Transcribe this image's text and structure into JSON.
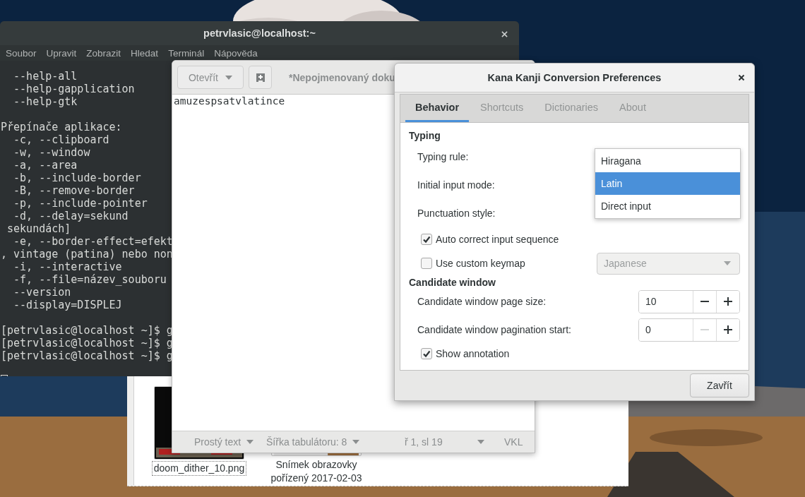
{
  "terminal": {
    "title": "petrvlasic@localhost:~",
    "menu": [
      "Soubor",
      "Upravit",
      "Zobrazit",
      "Hledat",
      "Terminál",
      "Nápověda"
    ],
    "line_groups": [
      [
        "  --help-all",
        "  --help-gapplication",
        "  --help-gtk"
      ],
      [
        "Přepínače aplikace:",
        "  -c, --clipboard",
        "  -w, --window",
        "  -a, --area",
        "  -b, --include-border",
        "  -B, --remove-border",
        "  -p, --include-pointer",
        "  -d, --delay=sekund",
        " sekundách]",
        "  -e, --border-effect=efekt",
        ", vintage (patina) nebo non",
        "  -i, --interactive",
        "  -f, --file=název_souboru",
        "  --version",
        "  --display=DISPLEJ"
      ],
      [
        "[petrvlasic@localhost ~]$ g",
        "[petrvlasic@localhost ~]$ g",
        "[petrvlasic@localhost ~]$ g"
      ]
    ]
  },
  "file_manager": {
    "files": [
      {
        "name_lines": [
          "doom_dither_10.png"
        ],
        "focused": true
      },
      {
        "name_lines": [
          "Snímek obrazovky",
          "pořízený 2017-02-03"
        ],
        "focused": false
      }
    ]
  },
  "text_editor": {
    "open_button": "Otevřít",
    "title": "*Nepojmenovaný doku",
    "content": "amuzespsatvlatince",
    "status_bar": {
      "language": "Prostý text",
      "tab_width": "Šířka tabulátoru: 8",
      "position": "ř 1, sl 19",
      "mode": "VKL"
    }
  },
  "dialog": {
    "title": "Kana Kanji Conversion Preferences",
    "tabs": [
      {
        "label": "Behavior",
        "selected": true
      },
      {
        "label": "Shortcuts",
        "selected": false
      },
      {
        "label": "Dictionaries",
        "selected": false
      },
      {
        "label": "About",
        "selected": false
      }
    ],
    "sections": [
      {
        "heading": "Typing",
        "rows": [
          {
            "kind": "combo",
            "label": "Typing rule:"
          },
          {
            "kind": "combo",
            "label": "Initial input mode:"
          },
          {
            "kind": "combo",
            "label": "Punctuation style:"
          },
          {
            "kind": "check",
            "label": "Auto correct input sequence",
            "checked": true
          },
          {
            "kind": "check",
            "label": "Use custom keymap",
            "checked": false,
            "combo": {
              "value": "Japanese",
              "disabled": true
            }
          }
        ]
      },
      {
        "heading": "Candidate window",
        "rows": [
          {
            "kind": "spin",
            "label": "Candidate window page size:",
            "value": "10",
            "minus_disabled": false
          },
          {
            "kind": "spin",
            "label": "Candidate window pagination start:",
            "value": "0",
            "minus_disabled": true
          },
          {
            "kind": "check",
            "label": "Show annotation",
            "checked": true
          }
        ]
      }
    ],
    "popup": [
      {
        "label": "Hiragana",
        "selected": false
      },
      {
        "label": "Latin",
        "selected": true
      },
      {
        "label": "Direct input",
        "selected": false
      }
    ],
    "close_button": "Zavřít"
  }
}
